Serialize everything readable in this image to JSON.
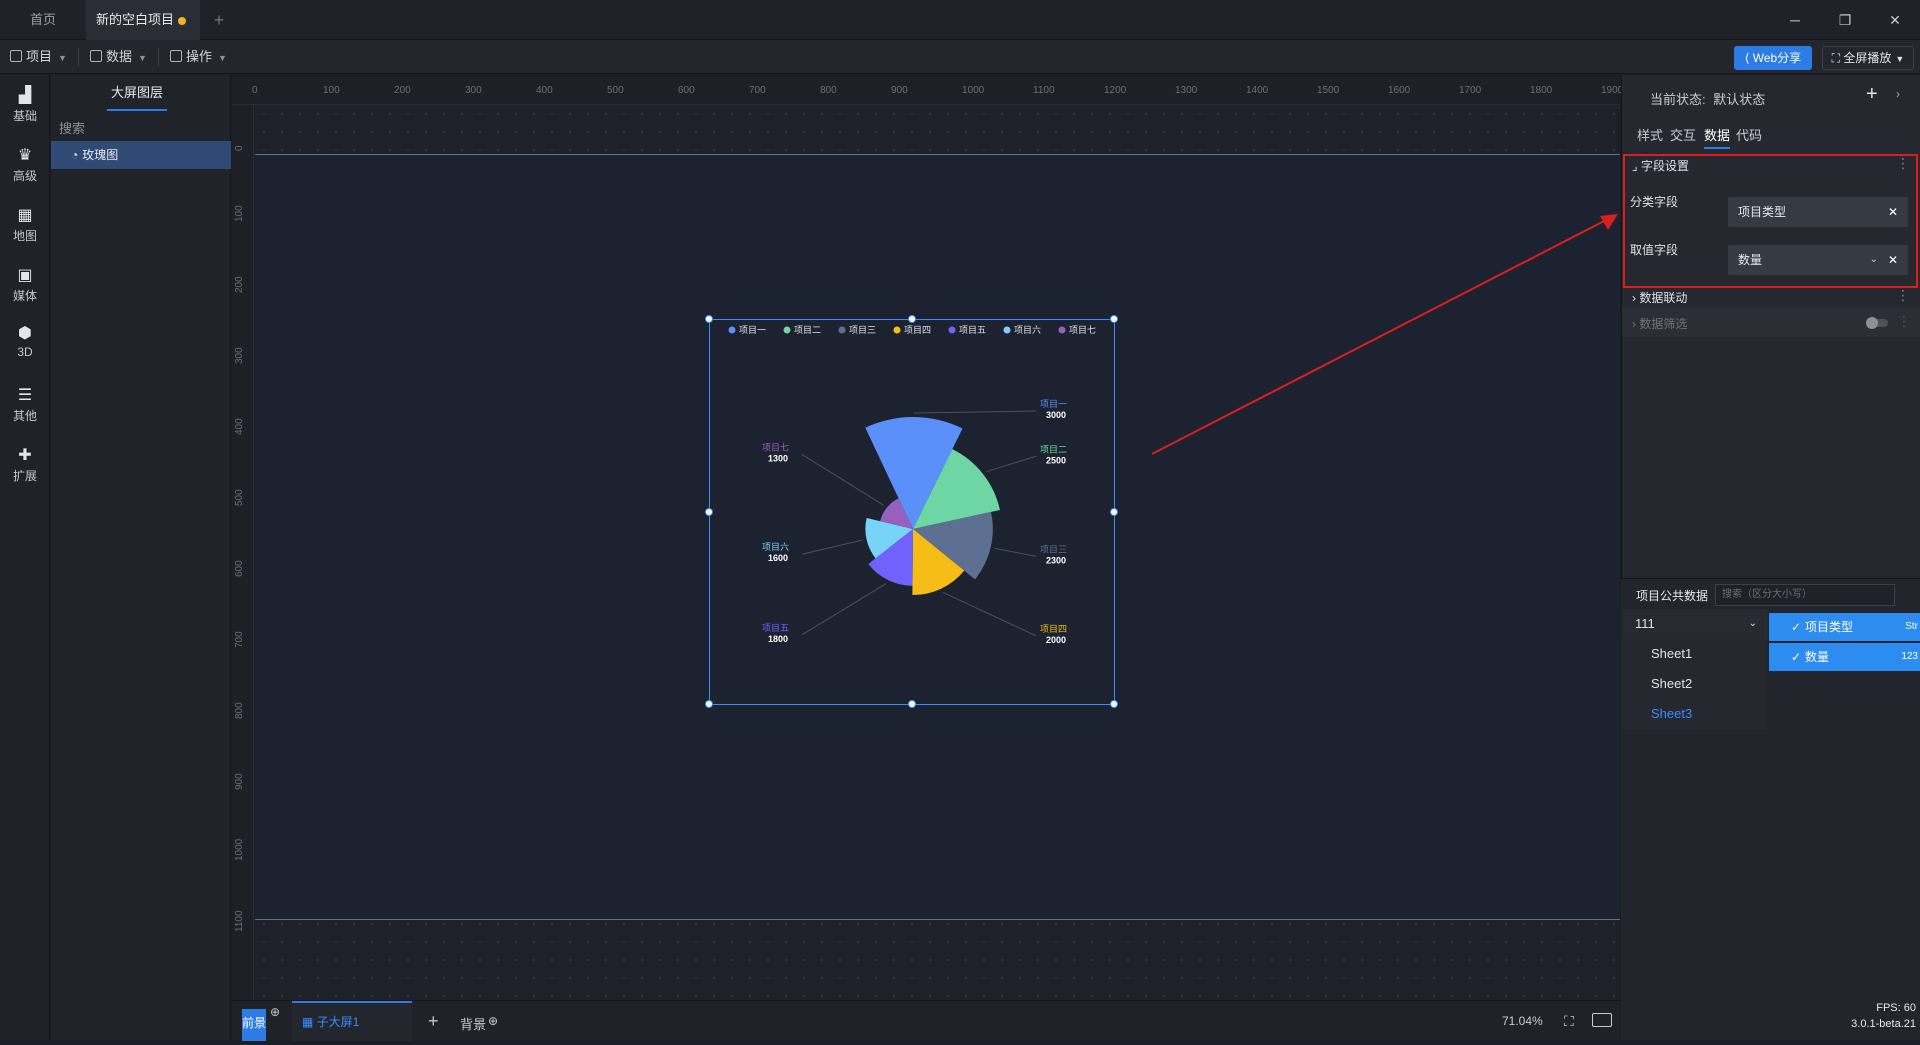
{
  "titlebar": {
    "tabs": [
      {
        "label": "首页"
      },
      {
        "label": "新的空白项目"
      }
    ],
    "add_tab": "+",
    "window_buttons": {
      "minimize": "─",
      "restore": "❐",
      "close": "✕"
    }
  },
  "menubar": {
    "items": [
      {
        "label": "项目"
      },
      {
        "label": "数据"
      },
      {
        "label": "操作"
      }
    ],
    "web_share": "Web分享",
    "fullscreen": "全屏播放"
  },
  "rail": {
    "items": [
      {
        "label": "基础",
        "icon": "bar-chart-icon"
      },
      {
        "label": "高级",
        "icon": "crown-icon"
      },
      {
        "label": "地图",
        "icon": "map-icon"
      },
      {
        "label": "媒体",
        "icon": "media-icon"
      },
      {
        "label": "3D",
        "icon": "cube-icon"
      },
      {
        "label": "其他",
        "icon": "list-icon"
      },
      {
        "label": "扩展",
        "icon": "puzzle-icon"
      }
    ]
  },
  "layers": {
    "tab": "大屏图层",
    "search_placeholder": "搜索",
    "items": [
      {
        "label": "玫瑰图"
      }
    ]
  },
  "rulers": {
    "top": [
      "0",
      "100",
      "200",
      "300",
      "400",
      "500",
      "600",
      "700",
      "800",
      "900",
      "1000",
      "1100",
      "1200",
      "1300",
      "1400",
      "1500",
      "1600",
      "1700",
      "1800",
      "1900"
    ],
    "left": [
      "0",
      "100",
      "200",
      "300",
      "400",
      "500",
      "600",
      "700",
      "800",
      "900",
      "1000",
      "1100"
    ]
  },
  "chart_data": {
    "type": "pie",
    "variant": "rose",
    "categories": [
      "项目一",
      "项目二",
      "项目三",
      "项目四",
      "项目五",
      "项目六",
      "项目七"
    ],
    "values": [
      3000,
      2500,
      2300,
      2000,
      1800,
      1600,
      1300
    ],
    "colors": [
      "#5b8ff9",
      "#6dd6a4",
      "#5d7092",
      "#f6bd16",
      "#7262fd",
      "#78d3f8",
      "#9661bc"
    ],
    "legend": "top"
  },
  "bottombar": {
    "foreground": "前景",
    "sub_screen": "子大屏1",
    "add": "+",
    "background": "背景",
    "zoom": "71.04%"
  },
  "rightpanel": {
    "state_label": "当前状态:",
    "state_value": "默认状态",
    "tabs": [
      "样式",
      "交互",
      "数据",
      "代码"
    ],
    "field_settings": "字段设置",
    "category_field_label": "分类字段",
    "category_field_value": "项目类型",
    "value_field_label": "取值字段",
    "value_field_value": "数量",
    "data_linkage": "数据联动",
    "data_filter": "数据筛选",
    "public_data_title": "项目公共数据",
    "public_search_placeholder": "搜索（区分大小写）",
    "datasource": "111",
    "sheets": [
      "Sheet1",
      "Sheet2",
      "Sheet3"
    ],
    "columns": [
      {
        "name": "项目类型",
        "type": "Str"
      },
      {
        "name": "数量",
        "type": "123"
      }
    ]
  },
  "status": {
    "fps": "FPS: 60",
    "version": "3.0.1-beta.21"
  }
}
